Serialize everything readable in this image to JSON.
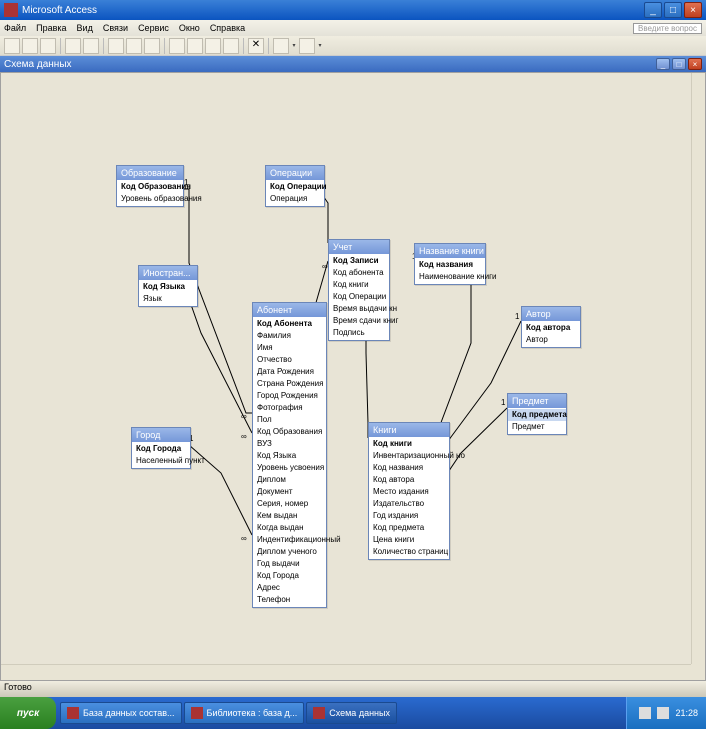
{
  "app": {
    "title": "Microsoft Access"
  },
  "menu": {
    "file": "Файл",
    "edit": "Правка",
    "view": "Вид",
    "relations": "Связи",
    "service": "Сервис",
    "window": "Окно",
    "help": "Справка",
    "ask": "Введите вопрос"
  },
  "schema_window": {
    "title": "Схема данных"
  },
  "status": {
    "text": "Готово"
  },
  "tables": {
    "education": {
      "title": "Образование",
      "fields": [
        "Код Образования",
        "Уровень образования"
      ],
      "pk": [
        0
      ]
    },
    "operation": {
      "title": "Операции",
      "fields": [
        "Код Операции",
        "Операция"
      ],
      "pk": [
        0
      ]
    },
    "language": {
      "title": "Иностран...",
      "fields": [
        "Код Языка",
        "Язык"
      ],
      "pk": [
        0
      ]
    },
    "uchet": {
      "title": "Учет",
      "fields": [
        "Код Записи",
        "Код абонента",
        "Код книги",
        "Код Операции",
        "Время выдачи кн",
        "Время сдачи книг",
        "Подпись"
      ],
      "pk": [
        0
      ]
    },
    "booktitle": {
      "title": "Название книги",
      "fields": [
        "Код названия",
        "Наименование книги"
      ],
      "pk": [
        0
      ]
    },
    "author": {
      "title": "Автор",
      "fields": [
        "Код автора",
        "Автор"
      ],
      "pk": [
        0
      ]
    },
    "abonent": {
      "title": "Абонент",
      "fields": [
        "Код Абонента",
        "Фамилия",
        "Имя",
        "Отчество",
        "Дата Рождения",
        "Страна Рождения",
        "Город Рождения",
        "Фотография",
        "Пол",
        "Код Образования",
        "ВУЗ",
        "Код Языка",
        "Уровень усвоения",
        "Диплом",
        "Документ",
        "Серия, номер",
        "Кем выдан",
        "Когда выдан",
        "Индентификационный",
        "Диплом ученого",
        "Год выдачи",
        "Код Города",
        "Адрес",
        "Телефон"
      ],
      "pk": [
        0
      ]
    },
    "city": {
      "title": "Город",
      "fields": [
        "Код Города",
        "Населенный пункт"
      ],
      "pk": [
        0
      ]
    },
    "book": {
      "title": "Книги",
      "fields": [
        "Код книги",
        "Инвентаризационный но",
        "Код названия",
        "Код автора",
        "Место издания",
        "Издательство",
        "Год издания",
        "Код предмета",
        "Цена книги",
        "Количество страниц"
      ],
      "pk": [
        0
      ]
    },
    "subject": {
      "title": "Предмет",
      "fields": [
        "Код предмета",
        "Предмет"
      ],
      "pk": [
        0
      ],
      "sel": [
        0
      ]
    }
  },
  "taskbar": {
    "start": "пуск",
    "items": [
      {
        "label": "База данных состав..."
      },
      {
        "label": "Библиотека : база д..."
      },
      {
        "label": "Схема данных"
      }
    ],
    "clock": "21:28"
  }
}
